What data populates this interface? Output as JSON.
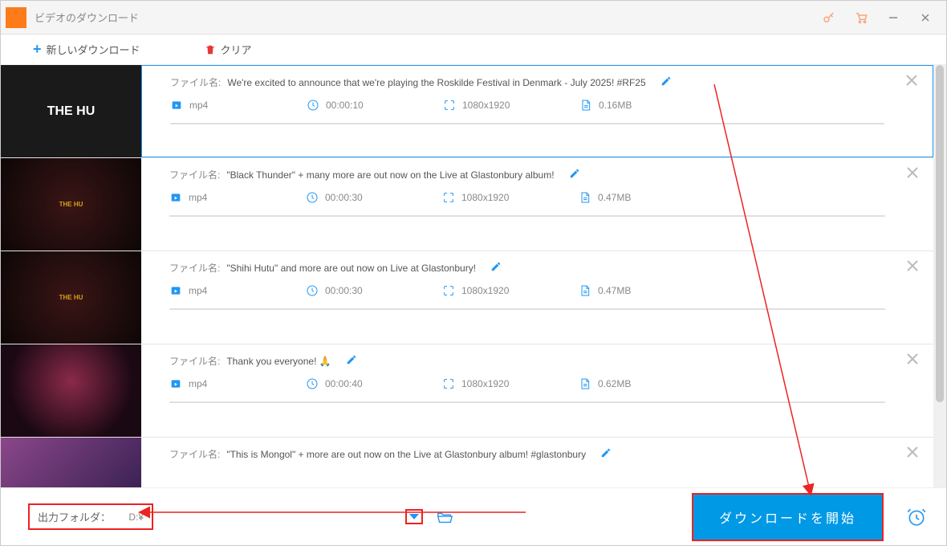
{
  "window": {
    "title": "ビデオのダウンロード"
  },
  "toolbar": {
    "new_download": "新しいダウンロード",
    "clear": "クリア"
  },
  "labels": {
    "filename": "ファイル名:"
  },
  "items": [
    {
      "thumb_text": "THE HU",
      "thumb_class": "",
      "filename": "We're excited to announce that we're playing the Roskilde Festival in Denmark - July 2025! #RF25",
      "format": "mp4",
      "duration": "00:00:10",
      "resolution": "1080x1920",
      "size": "0.16MB",
      "selected": true
    },
    {
      "thumb_text": "THE HU",
      "thumb_class": "album",
      "filename": "\"Black Thunder\" + many more are out now on the Live at Glastonbury album!",
      "format": "mp4",
      "duration": "00:00:30",
      "resolution": "1080x1920",
      "size": "0.47MB",
      "selected": false
    },
    {
      "thumb_text": "THE HU",
      "thumb_class": "album",
      "filename": "\"Shihi Hutu\" and more are out now on Live at Glastonbury!",
      "format": "mp4",
      "duration": "00:00:30",
      "resolution": "1080x1920",
      "size": "0.47MB",
      "selected": false
    },
    {
      "thumb_text": "",
      "thumb_class": "crowd",
      "filename": "Thank you everyone! 🙏",
      "format": "mp4",
      "duration": "00:00:40",
      "resolution": "1080x1920",
      "size": "0.62MB",
      "selected": false
    },
    {
      "thumb_text": "",
      "thumb_class": "disco",
      "filename": "\"This is Mongol\" + more are out now on the Live at Glastonbury album! #glastonbury",
      "format": "mp4",
      "duration": "",
      "resolution": "",
      "size": "",
      "selected": false
    }
  ],
  "footer": {
    "output_folder_label": "出力フォルダ：",
    "output_path": "D:¥",
    "start_button": "ダウンロードを開始"
  }
}
